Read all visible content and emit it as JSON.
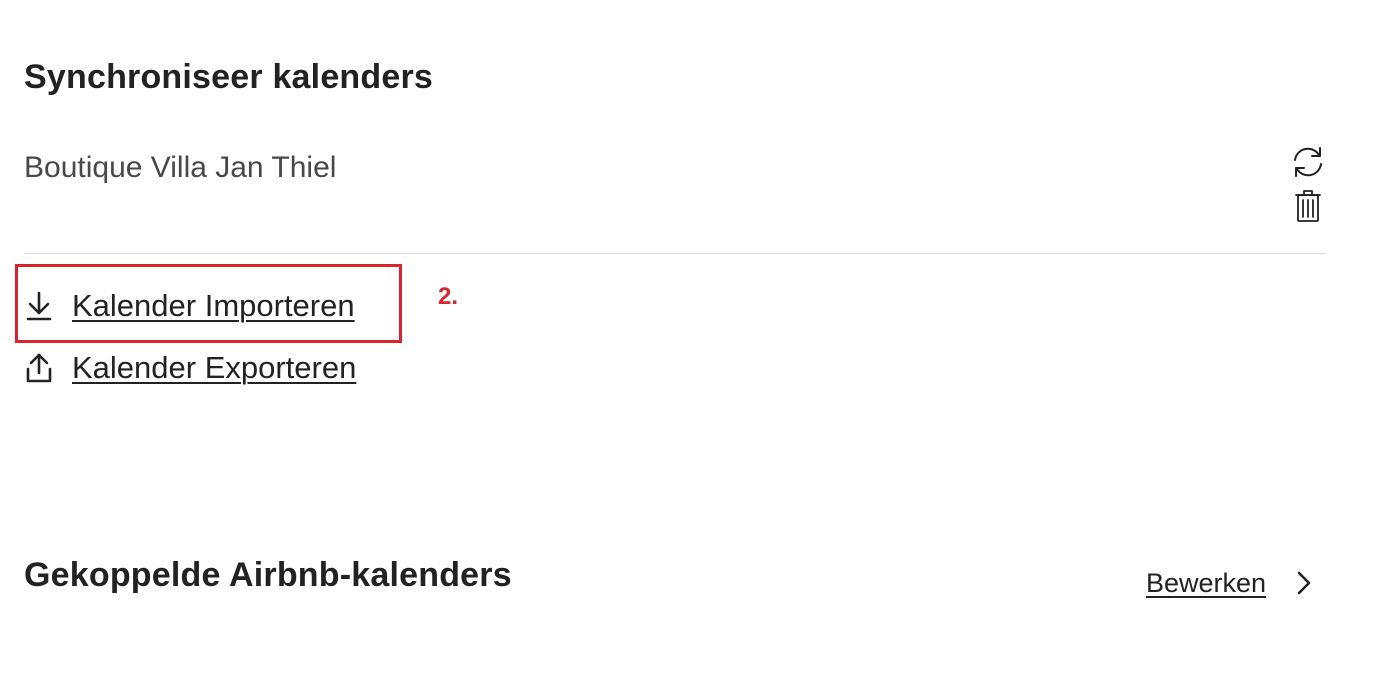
{
  "sync_section": {
    "title": "Synchroniseer kalenders",
    "calendar": {
      "name": "Boutique Villa Jan Thiel",
      "refresh_icon": "refresh-icon",
      "delete_icon": "trash-icon"
    },
    "import_label": "Kalender Importeren",
    "import_icon": "download-icon",
    "export_label": "Kalender Exporteren",
    "export_icon": "upload-icon"
  },
  "annotation": {
    "step_label": "2.",
    "color": "#d9262e"
  },
  "linked_section": {
    "title": "Gekoppelde Airbnb-kalenders",
    "edit_label": "Bewerken",
    "edit_icon": "chevron-right-icon"
  }
}
